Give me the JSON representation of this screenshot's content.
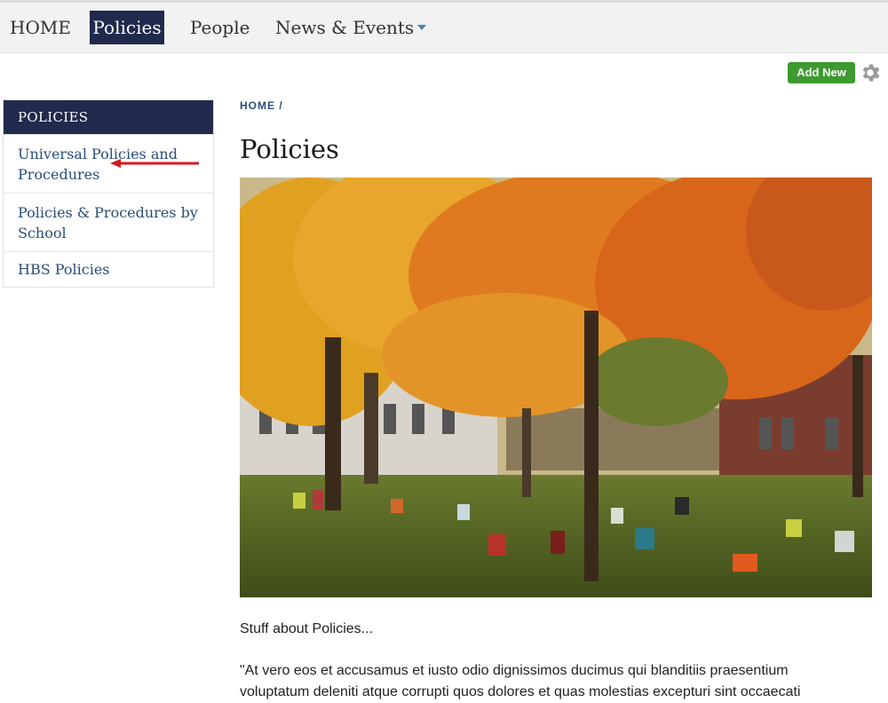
{
  "nav": {
    "home": "HOME",
    "policies": "Policies",
    "people": "People",
    "news_events": "News & Events"
  },
  "toolbar": {
    "add_new": "Add New",
    "settings_icon": "gear-icon"
  },
  "sidebar": {
    "header": "POLICIES",
    "items": [
      {
        "label": "Universal Policies and Procedures"
      },
      {
        "label": "Policies & Procedures by School"
      },
      {
        "label": "HBS Policies"
      }
    ],
    "annotation_color": "#d71920"
  },
  "breadcrumb": {
    "home": "HOME",
    "separator": "/"
  },
  "main": {
    "title": "Policies",
    "image_alt": "Autumn trees in a campus yard with people sitting on colorful chairs",
    "intro": "Stuff about Policies...",
    "quote": "\"At vero eos et accusamus et iusto odio dignissimos ducimus qui blanditiis praesentium voluptatum deleniti atque corrupti quos dolores et quas molestias excepturi sint occaecati"
  },
  "colors": {
    "nav_active": "#1f2a4d",
    "link": "#2a4d7a",
    "add_new": "#3c9a2e"
  }
}
